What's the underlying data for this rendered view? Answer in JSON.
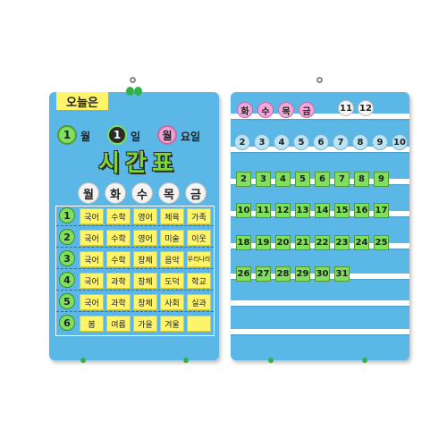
{
  "left_board": {
    "today_label": "오늘은",
    "date": {
      "month_value": "1",
      "month_unit": "월",
      "day_value": "1",
      "day_unit": "일",
      "weekday_value": "월",
      "weekday_unit": "요일"
    },
    "title": "시간표",
    "weekdays": [
      "월",
      "화",
      "수",
      "목",
      "금"
    ],
    "periods": [
      {
        "num": "1",
        "subjects": [
          "국어",
          "수학",
          "영어",
          "체육",
          "가족"
        ]
      },
      {
        "num": "2",
        "subjects": [
          "국어",
          "수학",
          "영어",
          "미술",
          "이웃"
        ]
      },
      {
        "num": "3",
        "subjects": [
          "국어",
          "수학",
          "창체",
          "음악",
          "우리나라"
        ]
      },
      {
        "num": "4",
        "subjects": [
          "국어",
          "과학",
          "창체",
          "도덕",
          "학교"
        ]
      },
      {
        "num": "5",
        "subjects": [
          "국어",
          "과학",
          "창체",
          "사회",
          "실과"
        ]
      },
      {
        "num": "6",
        "subjects": [
          "봄",
          "여름",
          "가을",
          "겨울",
          ""
        ]
      }
    ]
  },
  "right_board": {
    "row1_days": [
      "화",
      "수",
      "목",
      "금"
    ],
    "row1_nums": [
      "11",
      "12"
    ],
    "row2": [
      "2",
      "3",
      "4",
      "5",
      "6",
      "7",
      "8",
      "9",
      "10"
    ],
    "row3": [
      "2",
      "3",
      "4",
      "5",
      "6",
      "7",
      "8",
      "9"
    ],
    "row4": [
      "10",
      "11",
      "12",
      "13",
      "14",
      "15",
      "16",
      "17"
    ],
    "row5": [
      "18",
      "19",
      "20",
      "21",
      "22",
      "23",
      "24",
      "25"
    ],
    "row6": [
      "26",
      "27",
      "28",
      "29",
      "30",
      "31"
    ]
  },
  "colors": {
    "board": "#5bb8e6",
    "card_yellow": "#fff46a",
    "card_green": "#7ee05c",
    "flower_pink": "#f3a0d4"
  }
}
